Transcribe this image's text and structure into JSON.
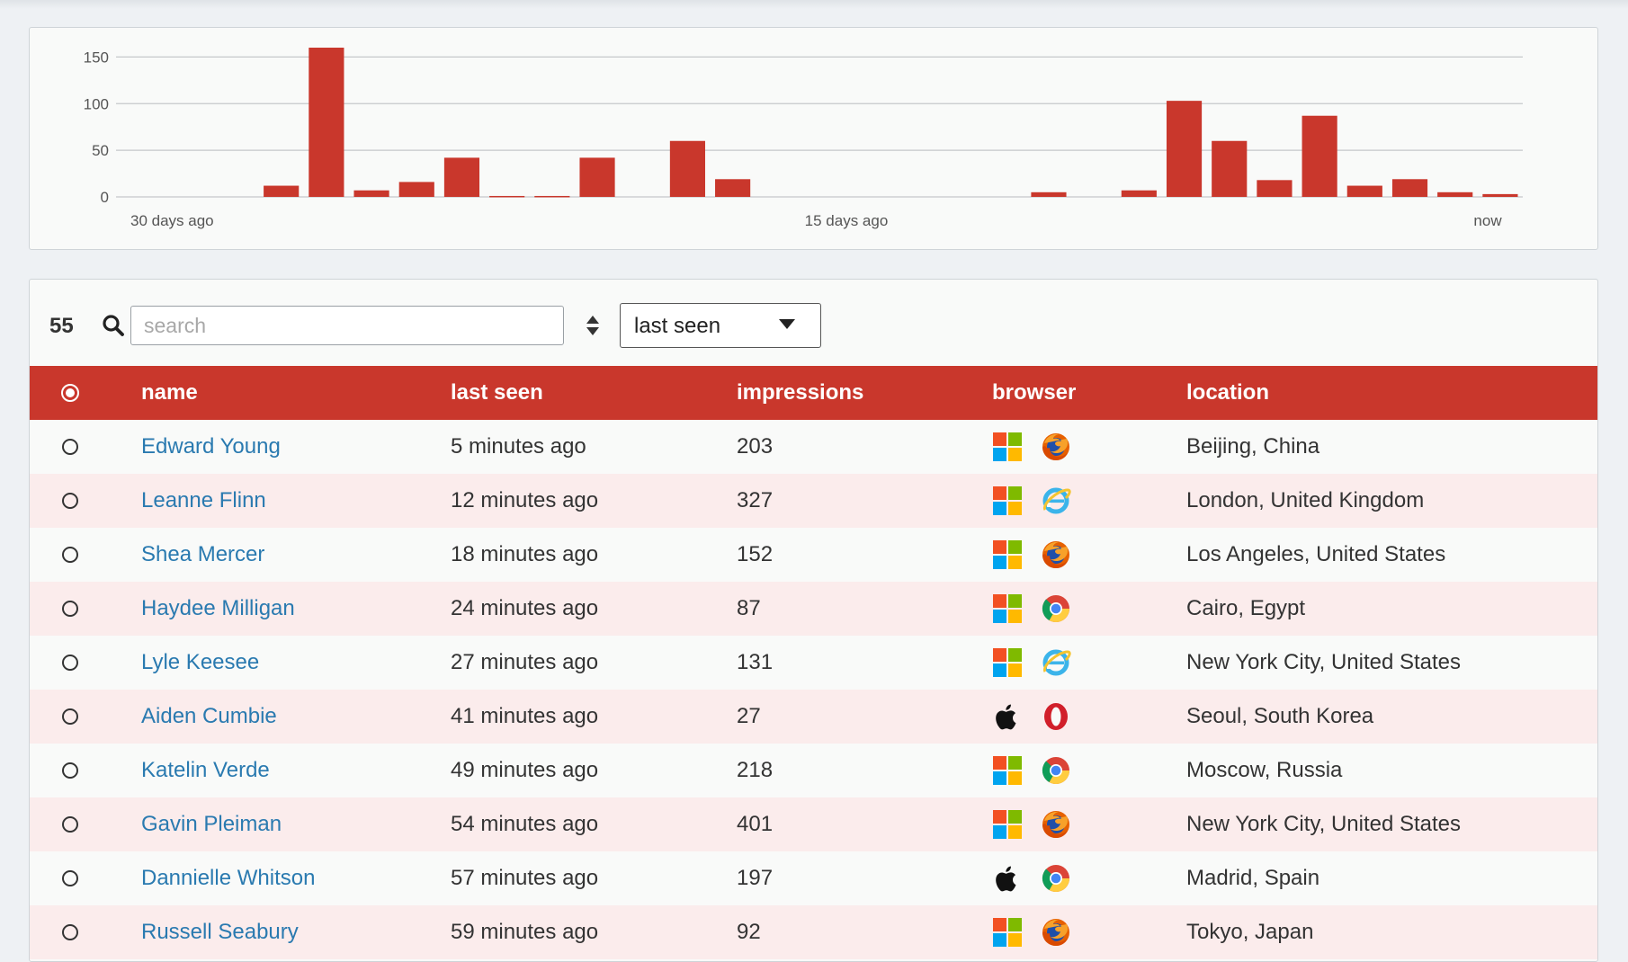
{
  "chart_data": {
    "type": "bar",
    "title": "",
    "xlabel": "",
    "ylabel": "",
    "ylim": [
      0,
      160
    ],
    "y_ticks": [
      "0",
      "50",
      "100",
      "150"
    ],
    "x_tick_labels": [
      "30 days ago",
      "15 days ago",
      "now"
    ],
    "color": "#c9372c",
    "grid": true,
    "categories": [
      30,
      29,
      28,
      27,
      26,
      25,
      24,
      23,
      22,
      21,
      20,
      19,
      18,
      17,
      16,
      15,
      14,
      13,
      12,
      11,
      10,
      9,
      8,
      7,
      6,
      5,
      4,
      3,
      2,
      1,
      0
    ],
    "values": [
      0,
      0,
      0,
      12,
      160,
      7,
      16,
      42,
      1,
      1,
      42,
      0,
      60,
      19,
      0,
      0,
      0,
      0,
      0,
      0,
      5,
      0,
      7,
      103,
      60,
      18,
      87,
      12,
      19,
      5,
      3
    ]
  },
  "toolbar": {
    "count": "55",
    "search_placeholder": "search",
    "sort_value": "last seen"
  },
  "table": {
    "headers": {
      "name": "name",
      "last_seen": "last seen",
      "impressions": "impressions",
      "browser": "browser",
      "location": "location"
    },
    "rows": [
      {
        "name": "Edward Young",
        "last_seen": "5 minutes ago",
        "impressions": "203",
        "os": "windows-icon",
        "browser": "firefox-icon",
        "location": "Beijing, China"
      },
      {
        "name": "Leanne Flinn",
        "last_seen": "12 minutes ago",
        "impressions": "327",
        "os": "windows-icon",
        "browser": "internet-explorer-icon",
        "location": "London, United Kingdom"
      },
      {
        "name": "Shea Mercer",
        "last_seen": "18 minutes ago",
        "impressions": "152",
        "os": "windows-icon",
        "browser": "firefox-icon",
        "location": "Los Angeles, United States"
      },
      {
        "name": "Haydee Milligan",
        "last_seen": "24 minutes ago",
        "impressions": "87",
        "os": "windows-icon",
        "browser": "chrome-icon",
        "location": "Cairo, Egypt"
      },
      {
        "name": "Lyle Keesee",
        "last_seen": "27 minutes ago",
        "impressions": "131",
        "os": "windows-icon",
        "browser": "internet-explorer-icon",
        "location": "New York City, United States"
      },
      {
        "name": "Aiden Cumbie",
        "last_seen": "41 minutes ago",
        "impressions": "27",
        "os": "apple-icon",
        "browser": "opera-icon",
        "location": "Seoul, South Korea"
      },
      {
        "name": "Katelin Verde",
        "last_seen": "49 minutes ago",
        "impressions": "218",
        "os": "windows-icon",
        "browser": "chrome-icon",
        "location": "Moscow, Russia"
      },
      {
        "name": "Gavin Pleiman",
        "last_seen": "54 minutes ago",
        "impressions": "401",
        "os": "windows-icon",
        "browser": "firefox-icon",
        "location": "New York City, United States"
      },
      {
        "name": "Dannielle Whitson",
        "last_seen": "57 minutes ago",
        "impressions": "197",
        "os": "apple-icon",
        "browser": "chrome-icon",
        "location": "Madrid, Spain"
      },
      {
        "name": "Russell Seabury",
        "last_seen": "59 minutes ago",
        "impressions": "92",
        "os": "windows-icon",
        "browser": "firefox-icon",
        "location": "Tokyo, Japan"
      }
    ]
  }
}
